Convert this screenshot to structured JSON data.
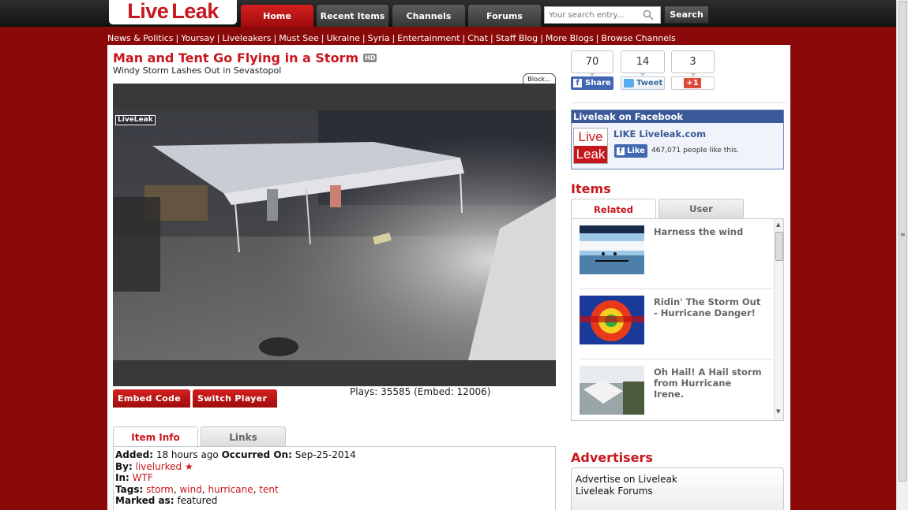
{
  "logo": {
    "part1": "Live",
    "part2": "Leak"
  },
  "nav": {
    "tabs": [
      "Home",
      "Recent Items",
      "Channels",
      "Forums"
    ],
    "search_placeholder": "Your search entry...",
    "search_button": "Search"
  },
  "subnav": [
    "News & Politics",
    "Yoursay",
    "Liveleakers",
    "Must See",
    "Ukraine",
    "Syria",
    "Entertainment",
    "Chat",
    "Staff Blog",
    "More Blogs",
    "Browse Channels"
  ],
  "item": {
    "title": "Man and Tent Go Flying in a Storm",
    "hd_badge": "HD",
    "subtitle": "Windy Storm Lashes Out in Sevastopol",
    "block_label": "Block...",
    "watermark": "LiveLeak",
    "plays": "Plays: 35585 (Embed: 12006)",
    "embed_button": "Embed Code",
    "switch_button": "Switch Player"
  },
  "info_tabs": [
    "Item Info",
    "Links"
  ],
  "info": {
    "added_label": "Added:",
    "added_value": "18 hours ago",
    "occurred_label": "Occurred On:",
    "occurred_value": "Sep-25-2014",
    "by_label": "By:",
    "by_value": "livelurked",
    "in_label": "In:",
    "in_value": "WTF",
    "tags_label": "Tags:",
    "tags": [
      "storm",
      "wind",
      "hurricane",
      "tent"
    ],
    "marked_label": "Marked as:",
    "marked_value": "featured"
  },
  "social": {
    "share_count": "70",
    "tweet_count": "14",
    "plus_count": "3",
    "share_label": "Share",
    "tweet_label": "Tweet",
    "plus_label": "+1"
  },
  "facebook": {
    "header": "Liveleak on Facebook",
    "page_name": "LIKE Liveleak.com",
    "like_label": "Like",
    "like_count": "467,071 people like this.",
    "logo_top": "Live",
    "logo_bottom": "Leak"
  },
  "items": {
    "heading": "Items",
    "tabs": [
      "Related",
      "User"
    ],
    "list": [
      {
        "title": "Harness the wind"
      },
      {
        "title": "Ridin' The Storm Out - Hurricane Danger!"
      },
      {
        "title": "Oh Hail! A Hail storm from Hurricane Irene."
      }
    ]
  },
  "advertisers": {
    "heading": "Advertisers",
    "links": [
      "Advertise on Liveleak",
      "Liveleak Forums"
    ]
  },
  "colors": {
    "brand_red": "#c8161d",
    "facebook_blue": "#3b5998",
    "background": "#8a0a0a"
  }
}
